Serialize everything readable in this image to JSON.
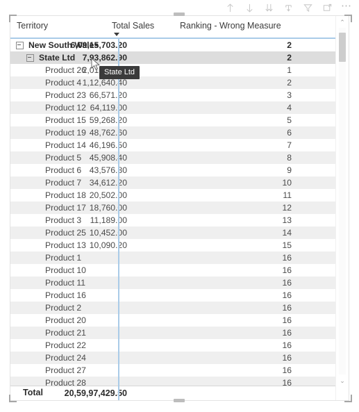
{
  "toolbar": {
    "icons": [
      {
        "name": "drill-up-icon",
        "title": "Drill up"
      },
      {
        "name": "drill-down-arrow-icon",
        "title": "Go to the next level in the hierarchy"
      },
      {
        "name": "expand-all-down-icon",
        "title": "Expand all down one level in the hierarchy"
      },
      {
        "name": "drill-mode-icon",
        "title": "Click to turn on Drill Down"
      },
      {
        "name": "filter-icon",
        "title": "Filters"
      },
      {
        "name": "focus-mode-icon",
        "title": "Focus mode"
      },
      {
        "name": "more-options-icon",
        "title": "More options"
      }
    ],
    "more_options_glyph": "⋯"
  },
  "table": {
    "columns": [
      {
        "key": "territory",
        "label": "Territory",
        "align": "left"
      },
      {
        "key": "total_sales",
        "label": "Total Sales",
        "align": "right",
        "sorted": true,
        "sort_direction": "desc"
      },
      {
        "key": "ranking",
        "label": "Ranking - Wrong Measure",
        "align": "right"
      }
    ],
    "rows": [
      {
        "level": 0,
        "expander": "collapse",
        "name": "New South Wales",
        "total_sales": "6,09,15,703.20",
        "ranking": "2",
        "selected": false,
        "alt": false
      },
      {
        "level": 1,
        "expander": "collapse",
        "name": "State Ltd",
        "total_sales": "7,93,862.90",
        "ranking": "2",
        "selected": true,
        "alt": false
      },
      {
        "level": 2,
        "expander": null,
        "name": "Product 26",
        "total_sales": "2,01,214.40",
        "ranking": "1",
        "selected": false,
        "alt": false
      },
      {
        "level": 2,
        "expander": null,
        "name": "Product 4",
        "total_sales": "1,12,640.40",
        "ranking": "2",
        "selected": false,
        "alt": true
      },
      {
        "level": 2,
        "expander": null,
        "name": "Product 23",
        "total_sales": "66,571.20",
        "ranking": "3",
        "selected": false,
        "alt": false
      },
      {
        "level": 2,
        "expander": null,
        "name": "Product 12",
        "total_sales": "64,119.00",
        "ranking": "4",
        "selected": false,
        "alt": true
      },
      {
        "level": 2,
        "expander": null,
        "name": "Product 15",
        "total_sales": "59,268.20",
        "ranking": "5",
        "selected": false,
        "alt": false
      },
      {
        "level": 2,
        "expander": null,
        "name": "Product 19",
        "total_sales": "48,762.60",
        "ranking": "6",
        "selected": false,
        "alt": true
      },
      {
        "level": 2,
        "expander": null,
        "name": "Product 14",
        "total_sales": "46,196.50",
        "ranking": "7",
        "selected": false,
        "alt": false
      },
      {
        "level": 2,
        "expander": null,
        "name": "Product 5",
        "total_sales": "45,908.40",
        "ranking": "8",
        "selected": false,
        "alt": true
      },
      {
        "level": 2,
        "expander": null,
        "name": "Product 6",
        "total_sales": "43,576.80",
        "ranking": "9",
        "selected": false,
        "alt": false
      },
      {
        "level": 2,
        "expander": null,
        "name": "Product 7",
        "total_sales": "34,612.20",
        "ranking": "10",
        "selected": false,
        "alt": true
      },
      {
        "level": 2,
        "expander": null,
        "name": "Product 18",
        "total_sales": "20,502.00",
        "ranking": "11",
        "selected": false,
        "alt": false
      },
      {
        "level": 2,
        "expander": null,
        "name": "Product 17",
        "total_sales": "18,760.00",
        "ranking": "12",
        "selected": false,
        "alt": true
      },
      {
        "level": 2,
        "expander": null,
        "name": "Product 3",
        "total_sales": "11,189.00",
        "ranking": "13",
        "selected": false,
        "alt": false
      },
      {
        "level": 2,
        "expander": null,
        "name": "Product 25",
        "total_sales": "10,452.00",
        "ranking": "14",
        "selected": false,
        "alt": true
      },
      {
        "level": 2,
        "expander": null,
        "name": "Product 13",
        "total_sales": "10,090.20",
        "ranking": "15",
        "selected": false,
        "alt": false
      },
      {
        "level": 2,
        "expander": null,
        "name": "Product 1",
        "total_sales": "",
        "ranking": "16",
        "selected": false,
        "alt": true
      },
      {
        "level": 2,
        "expander": null,
        "name": "Product 10",
        "total_sales": "",
        "ranking": "16",
        "selected": false,
        "alt": false
      },
      {
        "level": 2,
        "expander": null,
        "name": "Product 11",
        "total_sales": "",
        "ranking": "16",
        "selected": false,
        "alt": true
      },
      {
        "level": 2,
        "expander": null,
        "name": "Product 16",
        "total_sales": "",
        "ranking": "16",
        "selected": false,
        "alt": false
      },
      {
        "level": 2,
        "expander": null,
        "name": "Product 2",
        "total_sales": "",
        "ranking": "16",
        "selected": false,
        "alt": true
      },
      {
        "level": 2,
        "expander": null,
        "name": "Product 20",
        "total_sales": "",
        "ranking": "16",
        "selected": false,
        "alt": false
      },
      {
        "level": 2,
        "expander": null,
        "name": "Product 21",
        "total_sales": "",
        "ranking": "16",
        "selected": false,
        "alt": true
      },
      {
        "level": 2,
        "expander": null,
        "name": "Product 22",
        "total_sales": "",
        "ranking": "16",
        "selected": false,
        "alt": false
      },
      {
        "level": 2,
        "expander": null,
        "name": "Product 24",
        "total_sales": "",
        "ranking": "16",
        "selected": false,
        "alt": true
      },
      {
        "level": 2,
        "expander": null,
        "name": "Product 27",
        "total_sales": "",
        "ranking": "16",
        "selected": false,
        "alt": false
      },
      {
        "level": 2,
        "expander": null,
        "name": "Product 28",
        "total_sales": "",
        "ranking": "16",
        "selected": false,
        "alt": true
      }
    ],
    "total_row": {
      "label": "Total",
      "total_sales": "20,59,97,429.50",
      "ranking": ""
    }
  },
  "tooltip": {
    "text": "State Ltd"
  },
  "scrollbar": {
    "up_glyph": "⌃",
    "down_glyph": "⌄"
  },
  "colors": {
    "accent_rule": "#a9cbe8",
    "alt_row": "#efefef",
    "selected_row": "#dddddd",
    "tooltip_bg": "#3b3b3b",
    "text": "#4a4a4a"
  }
}
